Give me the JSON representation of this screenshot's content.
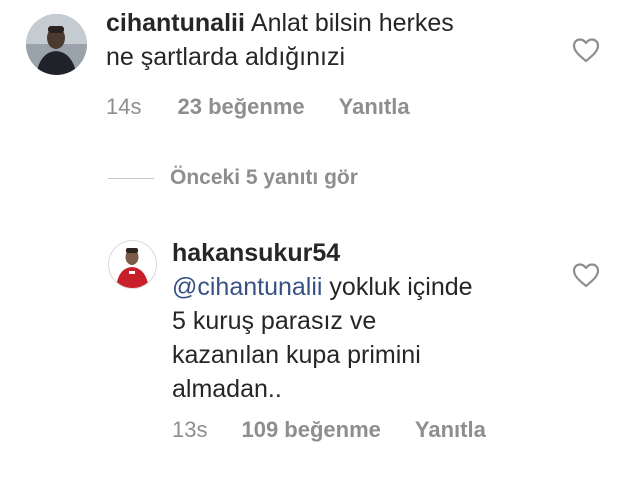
{
  "comments": [
    {
      "username": "cihantunalii",
      "text_line1": "Anlat bilsin herkes",
      "text_line2": "ne şartlarda aldığınızi",
      "time": "14s",
      "likes": "23 beğenme",
      "reply": "Yanıtla",
      "like_icon": "heart-outline-icon"
    },
    {
      "username": "hakansukur54",
      "mention": "@cihantunalii",
      "text_line1": "yokluk içinde",
      "text_line2": "5 kuruş parasız ve",
      "text_line3": "kazanılan kupa primini",
      "text_line4": "almadan..",
      "time": "13s",
      "likes": "109 beğenme",
      "reply": "Yanıtla",
      "like_icon": "heart-outline-icon"
    }
  ],
  "view_replies": {
    "label": "Önceki 5 yanıtı gör"
  },
  "colors": {
    "text": "#262626",
    "secondary": "#8e8e8e",
    "mention": "#385185"
  }
}
